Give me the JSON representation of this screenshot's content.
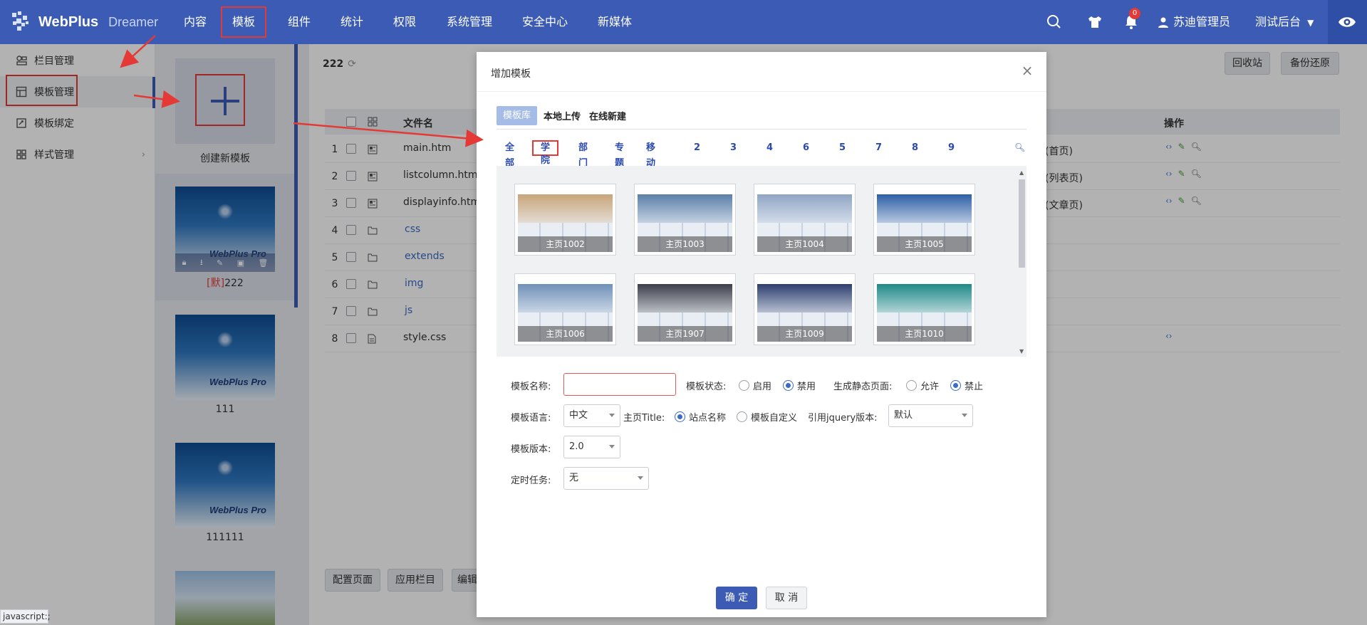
{
  "app": {
    "logo_text": "WebPlus",
    "logo_sub": "Dreamer"
  },
  "nav": {
    "items": [
      "内容",
      "模板",
      "组件",
      "统计",
      "权限",
      "系统管理",
      "安全中心",
      "新媒体"
    ],
    "active": "模板"
  },
  "topbar": {
    "badge_count": "0",
    "user": "苏迪管理员",
    "site": "测试后台"
  },
  "sidebar": {
    "items": [
      {
        "label": "栏目管理",
        "icon": "columns-icon"
      },
      {
        "label": "模板管理",
        "icon": "template-icon"
      },
      {
        "label": "模板绑定",
        "icon": "bind-icon"
      },
      {
        "label": "样式管理",
        "icon": "style-icon"
      }
    ]
  },
  "templates": {
    "create_label": "创建新模板",
    "default_tag": "[默]",
    "items": [
      {
        "name": "222",
        "thumb_text": "WebPlus Pro"
      },
      {
        "name": "111",
        "thumb_text": "WebPlus Pro"
      },
      {
        "name": "111111",
        "thumb_text": "WebPlus Pro"
      }
    ]
  },
  "main": {
    "breadcrumb": "222",
    "buttons": {
      "recycle": "回收站",
      "backup": "备份还原"
    },
    "table": {
      "headers": {
        "file": "文件名",
        "ops": "操作"
      },
      "rows": [
        {
          "n": "1",
          "name": "main.htm",
          "type": "(首页)",
          "icon": "page-icon",
          "dir": false,
          "ops": true
        },
        {
          "n": "2",
          "name": "listcolumn.htm",
          "type": "(列表页)",
          "icon": "page-icon",
          "dir": false,
          "ops": true
        },
        {
          "n": "3",
          "name": "displayinfo.htm",
          "type": "(文章页)",
          "icon": "page-icon",
          "dir": false,
          "ops": true
        },
        {
          "n": "4",
          "name": "css",
          "type": "",
          "icon": "folder-icon",
          "dir": true,
          "ops": false
        },
        {
          "n": "5",
          "name": "extends",
          "type": "",
          "icon": "folder-icon",
          "dir": true,
          "ops": false
        },
        {
          "n": "6",
          "name": "img",
          "type": "",
          "icon": "folder-icon",
          "dir": true,
          "ops": false
        },
        {
          "n": "7",
          "name": "js",
          "type": "",
          "icon": "folder-icon",
          "dir": true,
          "ops": false
        },
        {
          "n": "8",
          "name": "style.css",
          "type": "",
          "icon": "file-icon",
          "dir": false,
          "ops": "code"
        }
      ]
    },
    "bottom_buttons": [
      "配置页面",
      "应用栏目",
      "编辑"
    ]
  },
  "status_bar": "javascript:;",
  "dialog": {
    "title": "增加模板",
    "source_tabs": [
      "模板库",
      "本地上传",
      "在线新建"
    ],
    "categories": [
      "全部",
      "学院",
      "部门",
      "专题",
      "移动端",
      "2",
      "3",
      "4",
      "6",
      "5",
      "7",
      "8",
      "9"
    ],
    "gallery": [
      {
        "caption": "主页1002",
        "band": "#c8a57a"
      },
      {
        "caption": "主页1003",
        "band": "#5a7fa8"
      },
      {
        "caption": "主页1004",
        "band": "#8fa5c4"
      },
      {
        "caption": "主页1005",
        "band": "#2d5fa6"
      },
      {
        "caption": "主页1006",
        "band": "#6f90b8"
      },
      {
        "caption": "主页1907",
        "band": "#3c3f4a"
      },
      {
        "caption": "主页1009",
        "band": "#2d3f6e"
      },
      {
        "caption": "主页1010",
        "band": "#1e8a86"
      }
    ],
    "form": {
      "name_label": "模板名称:",
      "name_value": "",
      "status_label": "模板状态:",
      "status_options": [
        "启用",
        "禁用"
      ],
      "static_label": "生成静态页面:",
      "static_options": [
        "允许",
        "禁止"
      ],
      "lang_label": "模板语言:",
      "lang_value": "中文",
      "title_label": "主页Title:",
      "title_options": [
        "站点名称",
        "模板自定义"
      ],
      "jquery_label": "引用jquery版本:",
      "jquery_value": "默认",
      "version_label": "模板版本:",
      "version_value": "2.0",
      "task_label": "定时任务:",
      "task_value": "无"
    },
    "ok": "确 定",
    "cancel": "取 消"
  }
}
